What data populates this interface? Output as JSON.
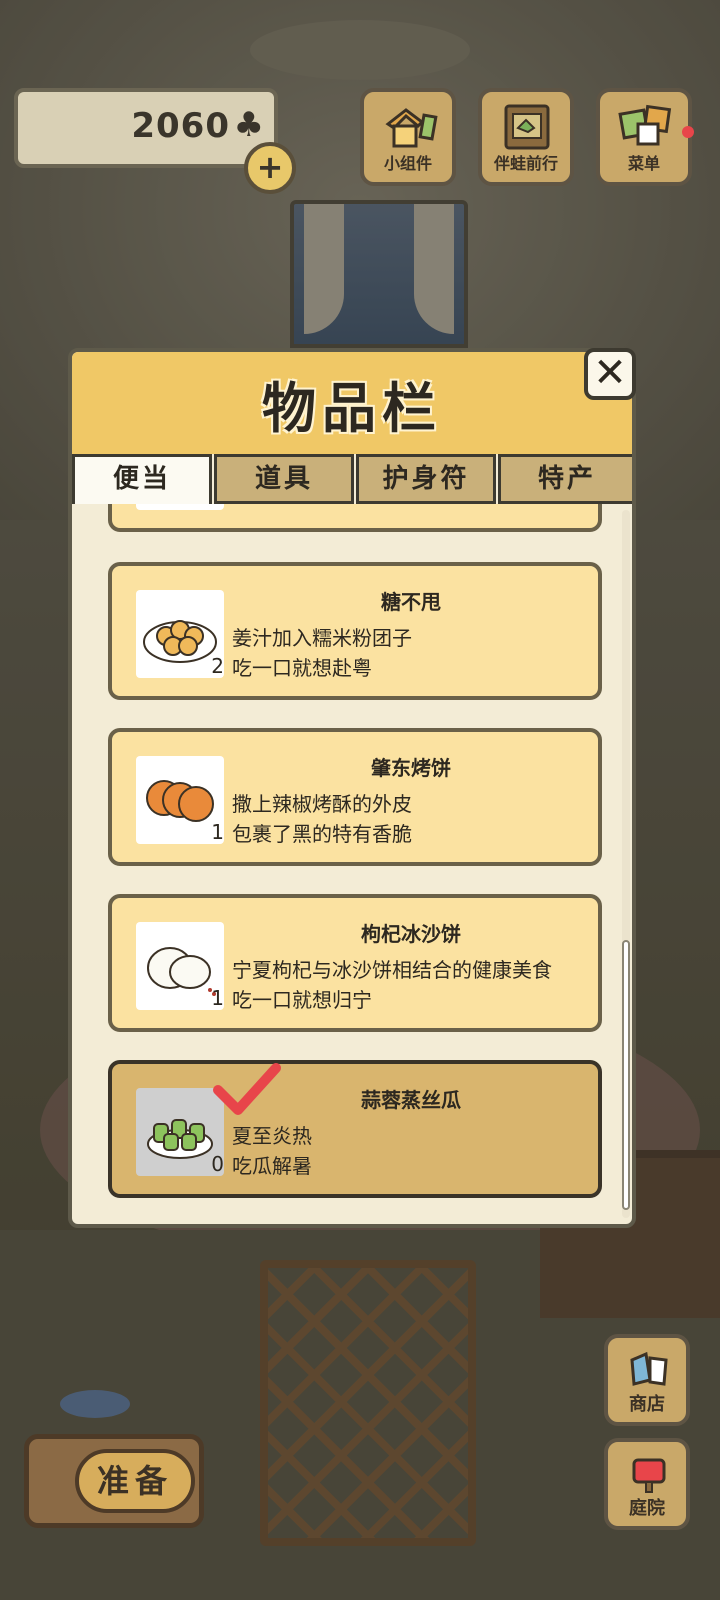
{
  "hud": {
    "clover_count": "2060",
    "clover_icon": "clover-icon",
    "plus_label": "+",
    "buttons": [
      {
        "label": "小组件",
        "icon": "house-widget-icon"
      },
      {
        "label": "伴蛙前行",
        "icon": "map-book-icon"
      },
      {
        "label": "菜单",
        "icon": "cards-menu-icon"
      }
    ]
  },
  "side_buttons": {
    "shop_label": "商店",
    "yard_label": "庭院"
  },
  "prepare_label": "准备",
  "panel": {
    "title": "物品栏",
    "close_label": "✕",
    "tabs": [
      {
        "label": "便当",
        "active": true
      },
      {
        "label": "道具",
        "active": false
      },
      {
        "label": "护身符",
        "active": false
      },
      {
        "label": "特产",
        "active": false
      }
    ],
    "items": [
      {
        "name": "",
        "desc1": "",
        "desc2": "",
        "qty": "",
        "partial": true
      },
      {
        "name": "糖不甩",
        "desc1": "姜汁加入糯米粉团子",
        "desc2": "吃一口就想赴粤",
        "qty": "2"
      },
      {
        "name": "肇东烤饼",
        "desc1": "撒上辣椒烤酥的外皮",
        "desc2": "包裹了黑的特有香脆",
        "qty": "1"
      },
      {
        "name": "枸杞冰沙饼",
        "desc1": "宁夏枸杞与冰沙饼相结合的健康美食",
        "desc2": "吃一口就想归宁",
        "qty": "1"
      },
      {
        "name": "蒜蓉蒸丝瓜",
        "desc1": "夏至炎热",
        "desc2": "吃瓜解暑",
        "qty": "0",
        "selected": true
      }
    ]
  },
  "colors": {
    "panel_header": "#f0c866",
    "item_bg": "#fbe2a1",
    "item_selected_bg": "#d9b56e",
    "check_red": "#e8454a"
  }
}
